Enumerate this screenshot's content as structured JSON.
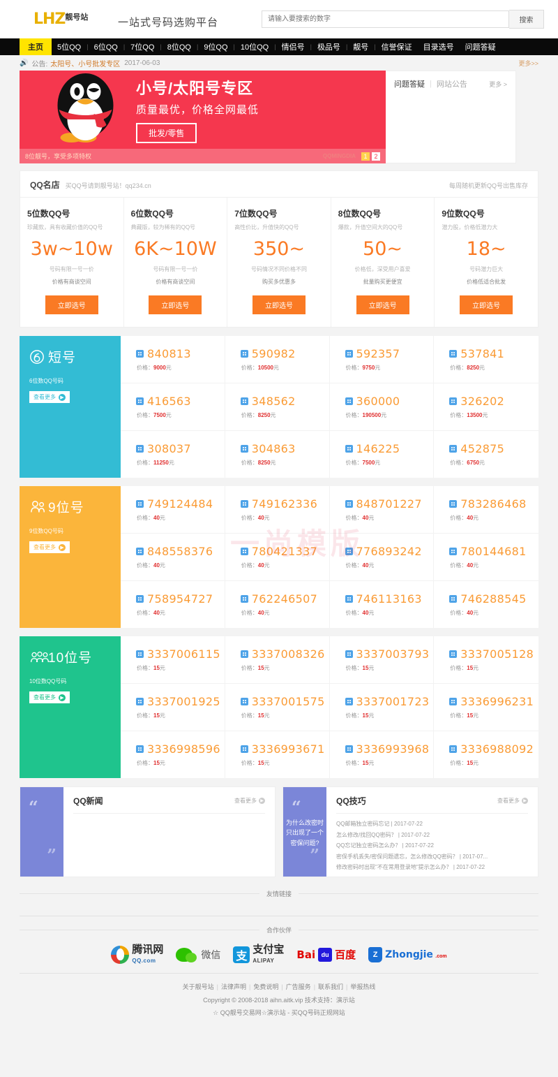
{
  "header": {
    "logo_main": "LHZ",
    "logo_cn": "靓号站",
    "slogan": "一站式号码选购平台",
    "search_placeholder": "请输入要搜索的数字",
    "search_value": "",
    "search_button": "搜索"
  },
  "nav": {
    "home": "主页",
    "items": [
      "5位QQ",
      "6位QQ",
      "7位QQ",
      "8位QQ",
      "9位QQ",
      "10位QQ",
      "情侣号",
      "极品号",
      "靓号",
      "信誉保证",
      "目录选号",
      "问题答疑"
    ]
  },
  "notice": {
    "icon": "speaker-icon",
    "label": "公告:",
    "text": "太阳号、小号批发专区",
    "date": "2017-06-03",
    "more": "更多>>"
  },
  "banner": {
    "title": "小号/太阳号专区",
    "subtitle": "质量最优，价格全网最低",
    "button": "批发/零售",
    "foot_left": "8位靓号，享受多项特权",
    "brand": "QQMINGDIA",
    "dots": [
      "1",
      "2"
    ],
    "active_dot": 0
  },
  "side_panel": {
    "tab_active": "问题答疑",
    "tab_other": "网站公告",
    "more": "更多 >"
  },
  "store": {
    "title": "QQ名店",
    "subtitle": "买QQ号请到靓号站！qq234.cn",
    "right_note": "每周随机更新QQ号出售库存",
    "cards": [
      {
        "title": "5位数QQ号",
        "desc": "珍藏款，具有收藏价值的QQ号",
        "price": "3w~10w",
        "note1": "号码有限一号一价",
        "note2": "价格有商谈空间",
        "button": "立即选号"
      },
      {
        "title": "6位数QQ号",
        "desc": "典藏版，较为稀有的QQ号",
        "price": "6K~10W",
        "note1": "号码有限一号一价",
        "note2": "价格有商谈空间",
        "button": "立即选号"
      },
      {
        "title": "7位数QQ号",
        "desc": "高性价比，升值快的QQ号",
        "price": "350~",
        "note1": "号码情况不同价格不同",
        "note2": "购买多优惠多",
        "button": "立即选号"
      },
      {
        "title": "8位数QQ号",
        "desc": "爆款，升值空间大的QQ号",
        "price": "50~",
        "note1": "价格低，深受用户喜爱",
        "note2": "批量购买更便宜",
        "button": "立即选号"
      },
      {
        "title": "9位数QQ号",
        "desc": "潜力股，价格低潜力大",
        "price": "18~",
        "note1": "号码潜力巨大",
        "note2": "价格低适合批发",
        "button": "立即选号"
      }
    ]
  },
  "blocks": [
    {
      "name": "短号",
      "icon": "circle-6-icon",
      "sub": "6位数QQ号码",
      "more": "查看更多",
      "color": "#33bcd4",
      "price_label": "价格：",
      "unit": "元",
      "items": [
        {
          "num": "840813",
          "price": "9000"
        },
        {
          "num": "590982",
          "price": "10500"
        },
        {
          "num": "592357",
          "price": "9750"
        },
        {
          "num": "537841",
          "price": "8250"
        },
        {
          "num": "416563",
          "price": "7500"
        },
        {
          "num": "348562",
          "price": "8250"
        },
        {
          "num": "360000",
          "price": "190500"
        },
        {
          "num": "326202",
          "price": "13500"
        },
        {
          "num": "308037",
          "price": "11250"
        },
        {
          "num": "304863",
          "price": "8250"
        },
        {
          "num": "146225",
          "price": "7500"
        },
        {
          "num": "452875",
          "price": "6750"
        }
      ]
    },
    {
      "name": "9位号",
      "icon": "two-person-icon",
      "sub": "9位数QQ号码",
      "more": "查看更多",
      "color": "#fbb53b",
      "price_label": "价格：",
      "unit": "元",
      "items": [
        {
          "num": "749124484",
          "price": "40"
        },
        {
          "num": "749162336",
          "price": "40"
        },
        {
          "num": "848701227",
          "price": "40"
        },
        {
          "num": "783286468",
          "price": "40"
        },
        {
          "num": "848558376",
          "price": "40"
        },
        {
          "num": "780421337",
          "price": "40"
        },
        {
          "num": "776893242",
          "price": "40"
        },
        {
          "num": "780144681",
          "price": "40"
        },
        {
          "num": "758954727",
          "price": "40"
        },
        {
          "num": "762246507",
          "price": "40"
        },
        {
          "num": "746113163",
          "price": "40"
        },
        {
          "num": "746288545",
          "price": "40"
        }
      ]
    },
    {
      "name": "10位号",
      "icon": "three-person-icon",
      "sub": "10位数QQ号码",
      "more": "查看更多",
      "color": "#1fc48d",
      "price_label": "价格：",
      "unit": "元",
      "items": [
        {
          "num": "3337006115",
          "price": "15"
        },
        {
          "num": "3337008326",
          "price": "15"
        },
        {
          "num": "3337003793",
          "price": "15"
        },
        {
          "num": "3337005128",
          "price": "15"
        },
        {
          "num": "3337001925",
          "price": "15"
        },
        {
          "num": "3337001575",
          "price": "15"
        },
        {
          "num": "3337001723",
          "price": "15"
        },
        {
          "num": "3336996231",
          "price": "15"
        },
        {
          "num": "3336998596",
          "price": "15"
        },
        {
          "num": "3336993671",
          "price": "15"
        },
        {
          "num": "3336993968",
          "price": "15"
        },
        {
          "num": "3336988092",
          "price": "15"
        }
      ]
    }
  ],
  "news": [
    {
      "quote_text": "",
      "title": "QQ新闻",
      "more": "查看更多",
      "items": []
    },
    {
      "quote_text": "为什么改密时只出现了一个密保问题?",
      "title": "QQ技巧",
      "more": "查看更多",
      "items": [
        "QQ邮箱独立密码忘记 | 2017-07-22",
        "怎么修改/找回QQ密码？ | 2017-07-22",
        "QQ忘记独立密码怎么办？ | 2017-07-22",
        "密保手机丢失/密保问题遗忘，怎么修改QQ密码？ | 2017-07...",
        "修改密码时出现\"不在常用登录地\"提示怎么办？ | 2017-07-22"
      ]
    }
  ],
  "sections": {
    "friend_links": "友情链接",
    "partners_label": "合作伙伴"
  },
  "partners": [
    {
      "name": "腾讯网",
      "sub": "QQ.com",
      "icon": "tencent-icon"
    },
    {
      "name": "微信",
      "sub": "",
      "icon": "wechat-icon"
    },
    {
      "name": "支付宝",
      "sub": "ALIPAY",
      "icon": "alipay-icon"
    },
    {
      "name": "百度",
      "sub": "Bai",
      "icon": "baidu-icon"
    },
    {
      "name": "Zhongjie",
      "sub": ".com",
      "icon": "zhongjie-icon"
    }
  ],
  "footer": {
    "links": [
      "关于靓号站",
      "法律声明",
      "免费说明",
      "广告服务",
      "联系我们",
      "举报热线"
    ],
    "copyright": "Copyright © 2008-2018 aihn.aitk.vip 技术支持：演示站",
    "bottom": "☆ QQ靓号交易网☆演示站 - 买QQ号码正规网站"
  },
  "watermark": "一尚模版"
}
